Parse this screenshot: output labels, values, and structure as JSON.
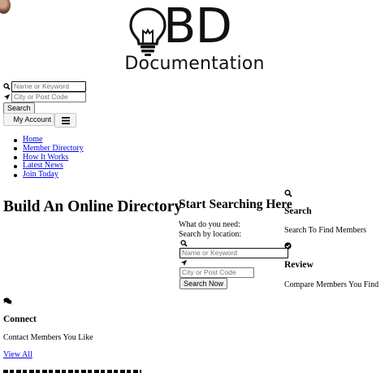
{
  "header": {
    "logo_mark": "BD",
    "logo_text": "Documentation"
  },
  "top_search": {
    "keyword_placeholder": "Name or Keyword",
    "location_placeholder": "City or Post Code",
    "search_label": "Search"
  },
  "account": {
    "label": "My Account"
  },
  "nav": {
    "items": [
      "Home",
      "Member Directory",
      "How It Works",
      "Latest News",
      "Join Today"
    ]
  },
  "hero": {
    "title": "Build An Online Directory"
  },
  "search_panel": {
    "title": "Start Searching Here",
    "what_label": "What do you need:",
    "location_label": "Search by location:",
    "keyword_placeholder": "Name or Keyword",
    "location_placeholder": "City or Post Code",
    "submit_label": "Search Now"
  },
  "features": [
    {
      "icon": "search-icon",
      "title": "Search",
      "text": "Search To Find Members"
    },
    {
      "icon": "check-circle-icon",
      "title": "Review",
      "text": "Compare Members You Find"
    },
    {
      "icon": "comments-icon",
      "title": "Connect",
      "text": "Contact Members You Like"
    }
  ],
  "view_all": "View All",
  "colors": {
    "link": "#0000ee",
    "text": "#000000",
    "background": "#ffffff"
  }
}
